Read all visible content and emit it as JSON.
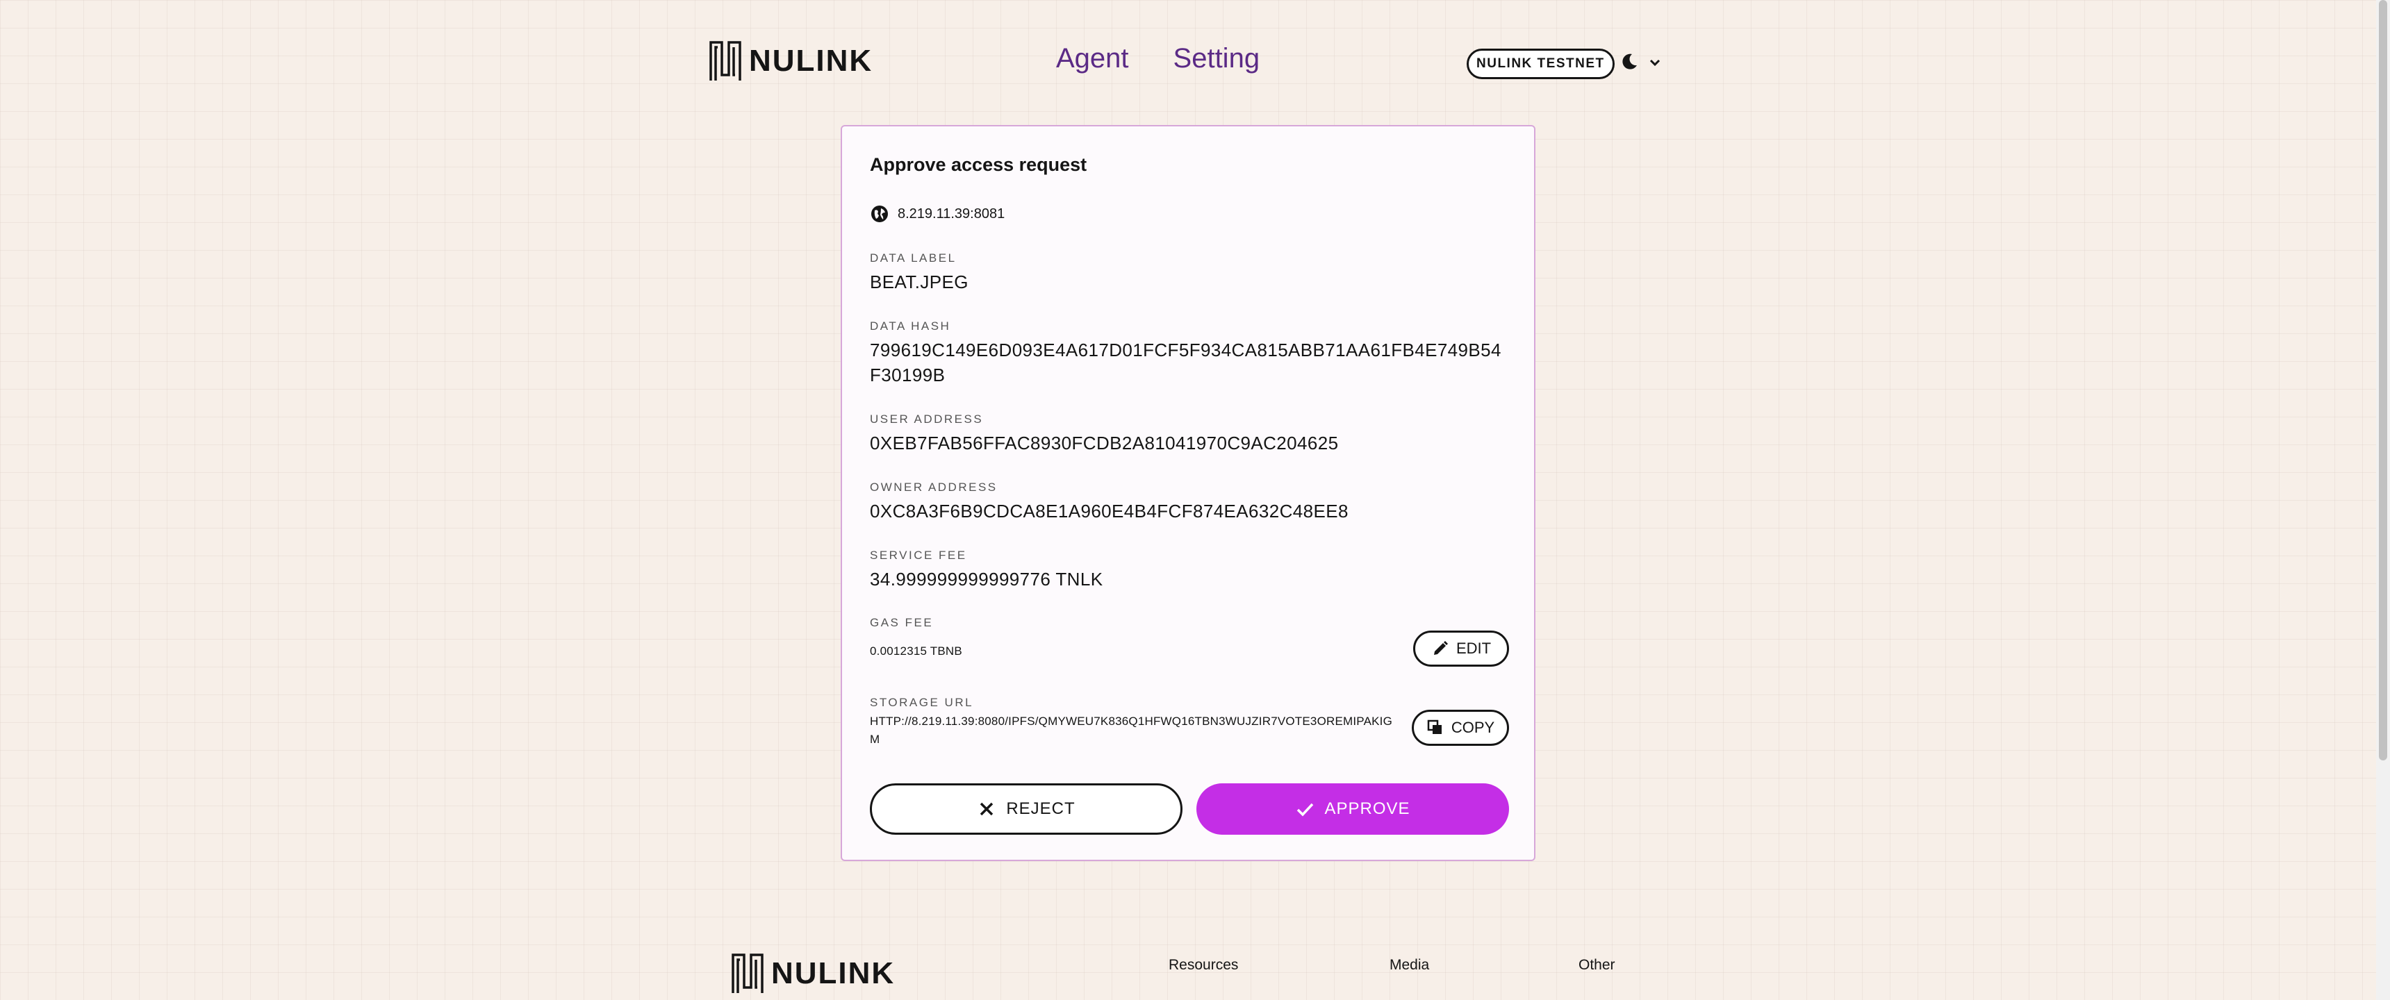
{
  "header": {
    "logo_text": "NULINK",
    "nav": [
      {
        "label": "Agent"
      },
      {
        "label": "Setting"
      }
    ],
    "network_badge": "NULINK TESTNET",
    "icons": {
      "theme": "moon-icon",
      "caret": "chevron-down-icon"
    }
  },
  "card": {
    "title": "Approve access request",
    "origin": "8.219.11.39:8081",
    "data_label": {
      "label": "DATA LABEL",
      "value": "BEAT.JPEG"
    },
    "data_hash": {
      "label": "DATA HASH",
      "value": "799619C149E6D093E4A617D01FCF5F934CA815ABB71AA61FB4E749B54F30199B"
    },
    "user_address": {
      "label": "USER ADDRESS",
      "value": "0XEB7FAB56FFAC8930FCDB2A81041970C9AC204625"
    },
    "owner_address": {
      "label": "OWNER ADDRESS",
      "value": "0XC8A3F6B9CDCA8E1A960E4B4FCF874EA632C48EE8"
    },
    "service_fee": {
      "label": "SERVICE FEE",
      "value": "34.999999999999776 TNLK"
    },
    "gas_fee": {
      "label": "GAS FEE",
      "value": "0.0012315 TBNB",
      "edit_label": "EDIT"
    },
    "storage_url": {
      "label": "STORAGE URL",
      "value": "HTTP://8.219.11.39:8080/IPFS/QMYWEU7K836Q1HFWQ16TBN3WUJZIR7VOTE3OREMIPAKIGM",
      "copy_label": "COPY"
    },
    "reject_label": "REJECT",
    "approve_label": "APPROVE"
  },
  "footer": {
    "logo_text": "NULINK",
    "columns": [
      {
        "label": "Resources"
      },
      {
        "label": "Media"
      },
      {
        "label": "Other"
      }
    ]
  },
  "colors": {
    "accent": "#c42ee6",
    "nav": "#5b2a86",
    "background": "#f7efe8",
    "card_border": "#d7a7d9"
  }
}
